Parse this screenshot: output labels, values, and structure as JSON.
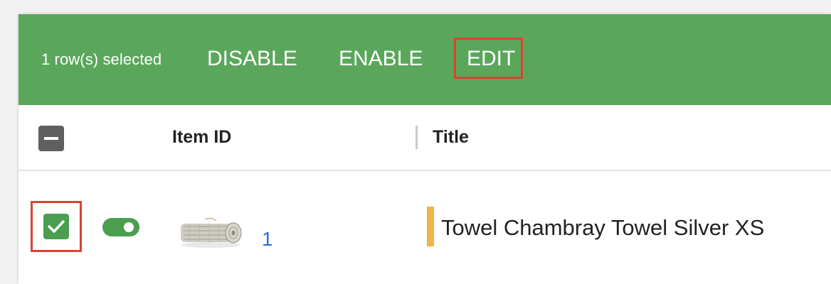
{
  "toolbar": {
    "selected_text": "1 row(s) selected",
    "disable_label": "DISABLE",
    "enable_label": "ENABLE",
    "edit_label": "EDIT",
    "background_color": "#5aa75c"
  },
  "table": {
    "columns": [
      "Item ID",
      "Title"
    ],
    "rows": [
      {
        "selected": true,
        "enabled": true,
        "thumbnail": "rolled-towel-image",
        "item_id": "1",
        "title": "Towel Chambray Towel Silver XS",
        "status_color": "#f0b447"
      }
    ]
  },
  "colors": {
    "highlight": "#d9442f",
    "link": "#2f6fd8",
    "check": "#4a9e4f"
  }
}
